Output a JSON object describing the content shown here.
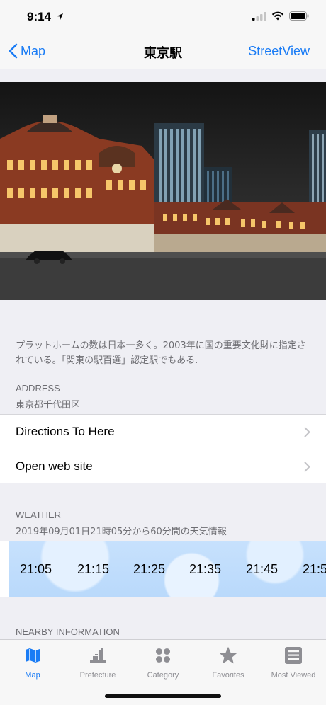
{
  "status_bar": {
    "time": "9:14"
  },
  "nav": {
    "back_label": "Map",
    "title": "東京駅",
    "right_label": "StreetView"
  },
  "description": "プラットホームの数は日本一多く。2003年に国の重要文化財に指定されている。「関東の駅百選」認定駅でもある.",
  "address": {
    "header": "ADDRESS",
    "value": "東京都千代田区"
  },
  "actions": [
    {
      "label": "Directions To Here"
    },
    {
      "label": "Open web site"
    }
  ],
  "weather": {
    "header": "WEATHER",
    "subtitle": "2019年09月01日21時05分から60分間の天気情報",
    "times": [
      "21:05",
      "21:15",
      "21:25",
      "21:35",
      "21:45",
      "21:5"
    ]
  },
  "nearby": {
    "header": "NEARBY INFORMATION"
  },
  "tabs": [
    {
      "label": "Map",
      "icon": "map-icon",
      "active": true
    },
    {
      "label": "Prefecture",
      "icon": "prefecture-icon",
      "active": false
    },
    {
      "label": "Category",
      "icon": "category-icon",
      "active": false
    },
    {
      "label": "Favorites",
      "icon": "star-icon",
      "active": false
    },
    {
      "label": "Most Viewed",
      "icon": "list-icon",
      "active": false
    }
  ],
  "colors": {
    "accent": "#1a7cf5",
    "inactive": "#8e8e93",
    "background": "#efeff4"
  }
}
